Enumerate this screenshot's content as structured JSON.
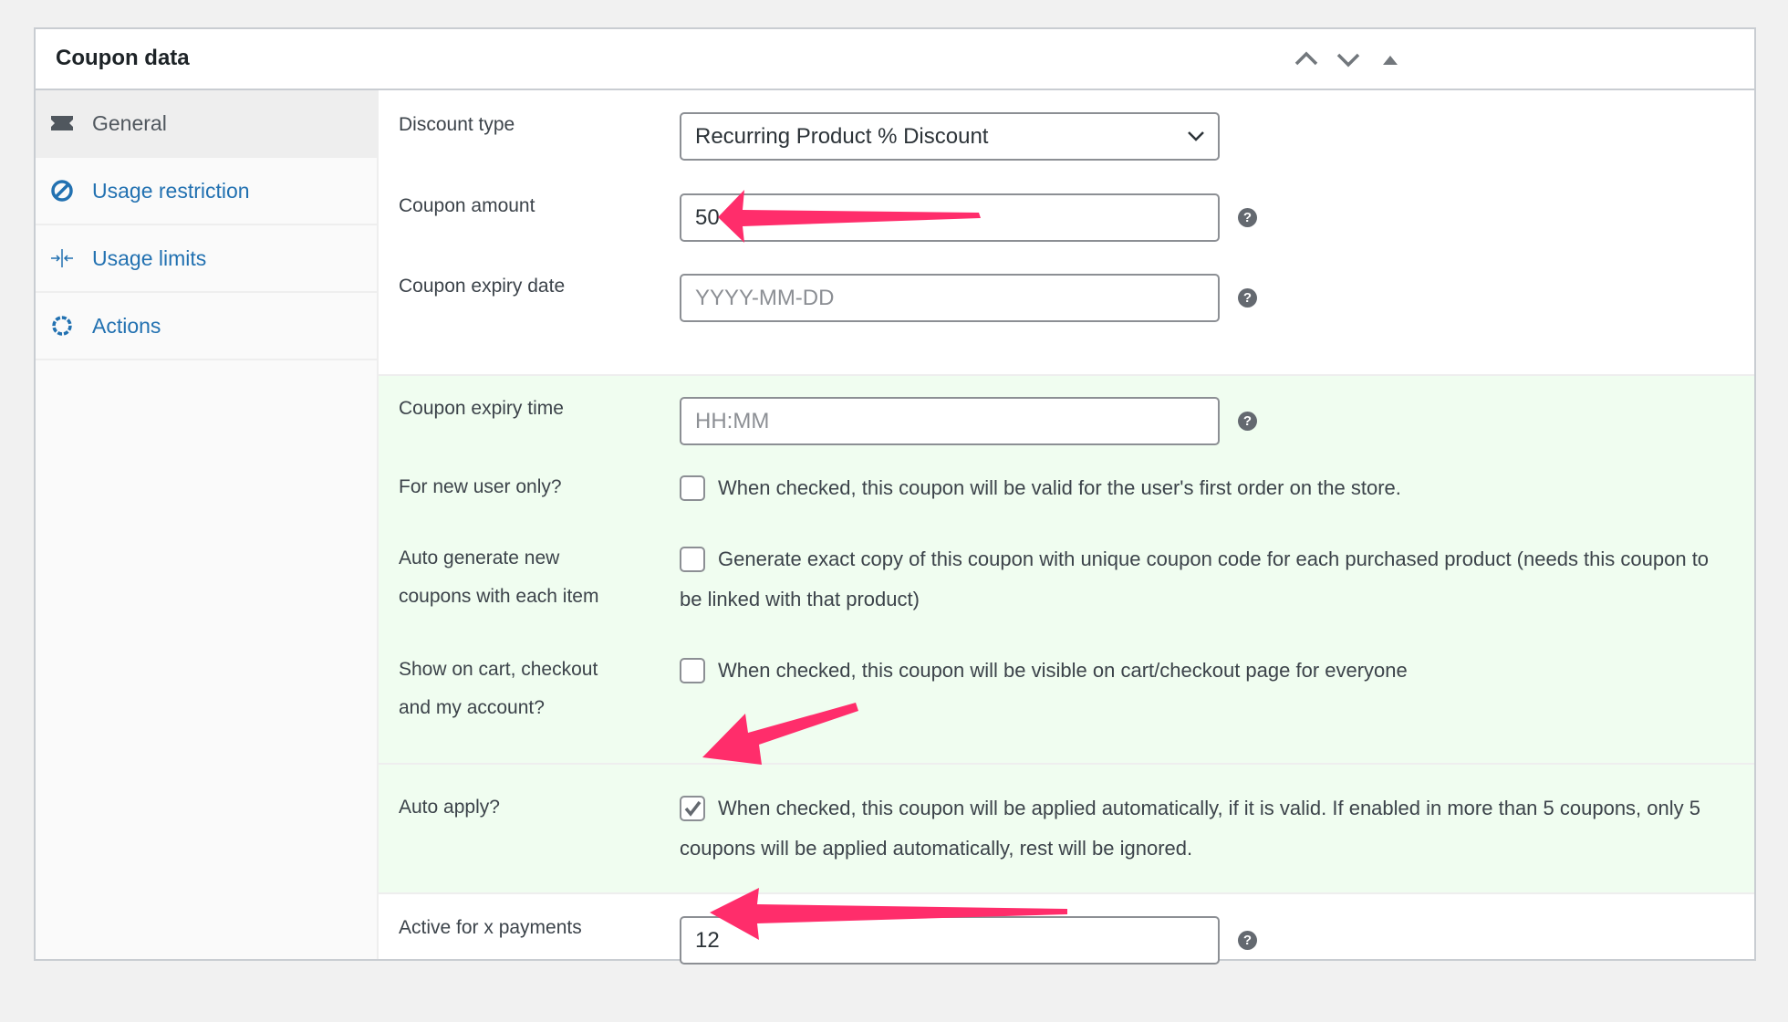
{
  "panel": {
    "title": "Coupon data",
    "icons": [
      "chevron-up-icon",
      "chevron-down-icon",
      "triangle-up-icon"
    ]
  },
  "tabs": [
    {
      "label": "General",
      "icon": "ticket-icon",
      "active": true
    },
    {
      "label": "Usage restriction",
      "icon": "no-entry-icon"
    },
    {
      "label": "Usage limits",
      "icon": "arrows-in-icon"
    },
    {
      "label": "Actions",
      "icon": "gear-icon"
    }
  ],
  "fields": {
    "discount_type": {
      "label": "Discount type",
      "value": "Recurring Product % Discount"
    },
    "coupon_amount": {
      "label": "Coupon amount",
      "value": "50"
    },
    "expiry_date": {
      "label": "Coupon expiry date",
      "placeholder": "YYYY-MM-DD"
    },
    "expiry_time": {
      "label": "Coupon expiry time",
      "placeholder": "HH:MM"
    },
    "new_user": {
      "label": "For new user only?",
      "desc": "When checked, this coupon will be valid for the user's first order on the store.",
      "checked": false
    },
    "auto_generate": {
      "label1": "Auto generate new",
      "label2": "coupons with each item",
      "desc": "Generate exact copy of this coupon with unique coupon code for each purchased product (needs this coupon to be linked with that product)",
      "checked": false
    },
    "show_on_cart": {
      "label1": "Show on cart, checkout",
      "label2": "and my account?",
      "desc": "When checked, this coupon will be visible on cart/checkout page for everyone",
      "checked": false
    },
    "auto_apply": {
      "label": "Auto apply?",
      "desc": "When checked, this coupon will be applied automatically, if it is valid. If enabled in more than 5 coupons, only 5 coupons will be applied automatically, rest will be ignored.",
      "checked": true
    },
    "active_payments": {
      "label": "Active for x payments",
      "value": "12"
    }
  },
  "help_icon": "?",
  "colors": {
    "accent": "#2271b1",
    "highlight": "#f0fdf0",
    "annotation_arrow": "#ff2d6b"
  }
}
